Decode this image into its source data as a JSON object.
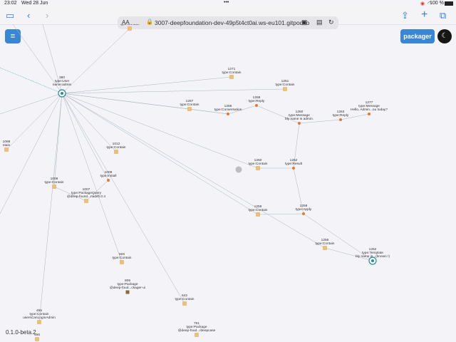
{
  "statusbar": {
    "time": "23:02",
    "date": "Wed 28 Jun",
    "dots": "•••",
    "battery": "100 %"
  },
  "toolbar": {
    "aa": "AA",
    "url": "3007-deepfoundation-dev-49p5t4ct0ai.ws-eu101.gitpod.io"
  },
  "buttons": {
    "menu": "≡",
    "packager": "packager",
    "theme": "☾"
  },
  "version": "0.1.0-beta.2",
  "nodes": [
    {
      "id": "user",
      "lines": [
        "380",
        "type:User",
        "name:admin"
      ]
    },
    {
      "id": "topcontain",
      "lines": [
        "type:Contain"
      ]
    },
    {
      "id": "n1271",
      "lines": [
        "1271",
        "type:Contain"
      ]
    },
    {
      "id": "n1251",
      "lines": [
        "1251",
        "type:Contain"
      ]
    },
    {
      "id": "n1267",
      "lines": [
        "1267",
        "type:Contain"
      ]
    },
    {
      "id": "n1266",
      "lines": [
        "1266",
        "type:Conversation"
      ]
    },
    {
      "id": "n1268",
      "lines": [
        "1268",
        "type:Reply"
      ]
    },
    {
      "id": "n1250",
      "lines": [
        "1250",
        "type:Message",
        "bly name is admin."
      ]
    },
    {
      "id": "n1263",
      "lines": [
        "1263",
        "type:Reply"
      ]
    },
    {
      "id": "n1277",
      "lines": [
        "1277",
        "type:Message",
        "Hello, Admin...ou today?"
      ]
    },
    {
      "id": "n1088",
      "lines": [
        "1088",
        "ntain"
      ]
    },
    {
      "id": "n1012",
      "lines": [
        "1012",
        "type:Contain"
      ]
    },
    {
      "id": "n1008",
      "lines": [
        "1008",
        "type:Contain"
      ]
    },
    {
      "id": "n1009",
      "lines": [
        "1009",
        "type:Install"
      ]
    },
    {
      "id": "n1007",
      "lines": [
        "1007",
        "type:PackageQuery",
        "@deep-found...nadi/0.0.4"
      ]
    },
    {
      "id": "n1260",
      "lines": [
        "1260",
        "type:Contain"
      ]
    },
    {
      "id": "n1262r",
      "lines": [
        "1262",
        "type:Result"
      ]
    },
    {
      "id": "n1258",
      "lines": [
        "1258",
        "type:Apply"
      ]
    },
    {
      "id": "n1259",
      "lines": [
        "1259",
        "type:Contain"
      ]
    },
    {
      "id": "n1256",
      "lines": [
        "1256",
        "type:Contain"
      ]
    },
    {
      "id": "n1252",
      "lines": [
        "1252",
        "type:Template",
        "bly name is...(known !)"
      ]
    },
    {
      "id": "n926",
      "lines": [
        "926",
        "type:Contain"
      ]
    },
    {
      "id": "n809",
      "lines": [
        "809",
        "type:Package",
        "@deep-foud...ckager-ui"
      ]
    },
    {
      "id": "n842",
      "lines": [
        "842",
        "type:Contain"
      ]
    },
    {
      "id": "n761",
      "lines": [
        "761",
        "type:Package",
        "@deep-foud.../deepcase"
      ]
    },
    {
      "id": "n455",
      "lines": [
        "455",
        "type:Contain",
        "usersCanLoginAdmin"
      ]
    },
    {
      "id": "n456",
      "lines": [
        "456"
      ]
    }
  ]
}
